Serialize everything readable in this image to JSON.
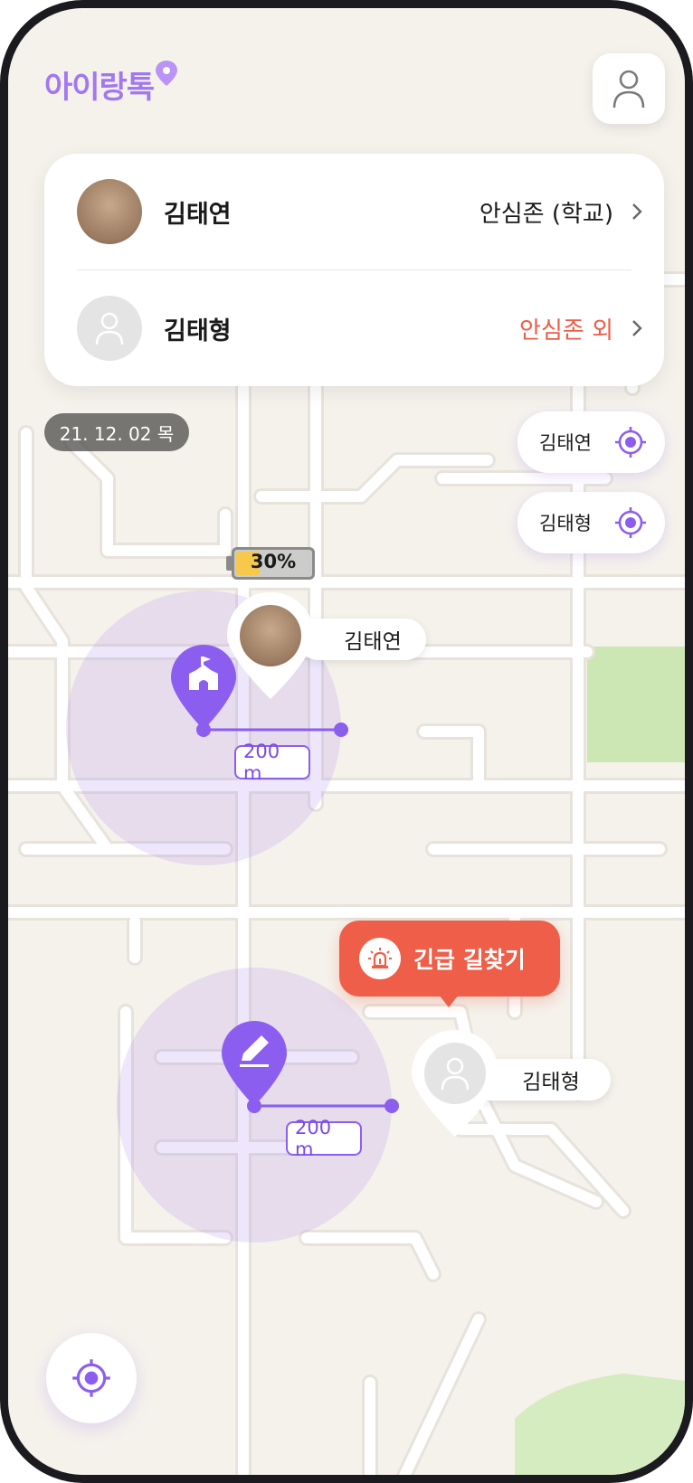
{
  "app": {
    "logo_text": "아이랑톡",
    "brand_color": "#a277f2"
  },
  "header": {
    "profile_icon": "person-outline-icon"
  },
  "children": [
    {
      "name": "김태연",
      "zone_status": "안심존 (학교)",
      "zone_color": "#1a1a1a",
      "avatar": "child-photo"
    },
    {
      "name": "김태형",
      "zone_status": "안심존 외",
      "zone_color": "#ef5b45",
      "avatar": "person-placeholder-icon"
    }
  ],
  "map": {
    "date": "21. 12. 02 목",
    "locate_chips": [
      {
        "label": "김태연",
        "icon": "crosshair-icon"
      },
      {
        "label": "김태형",
        "icon": "crosshair-icon"
      }
    ],
    "battery": {
      "label": "30%",
      "level": 0.3
    },
    "markers": [
      {
        "name": "김태연",
        "avatar": "child-photo"
      },
      {
        "name": "김태형",
        "avatar": "person-placeholder-icon"
      }
    ],
    "safe_zones": [
      {
        "icon": "school-icon",
        "radius_label": "200 m"
      },
      {
        "icon": "pencil-icon",
        "radius_label": "200 m"
      }
    ],
    "emergency_button": {
      "label": "긴급 길찾기",
      "icon": "siren-icon"
    },
    "my_location_icon": "crosshair-icon"
  }
}
